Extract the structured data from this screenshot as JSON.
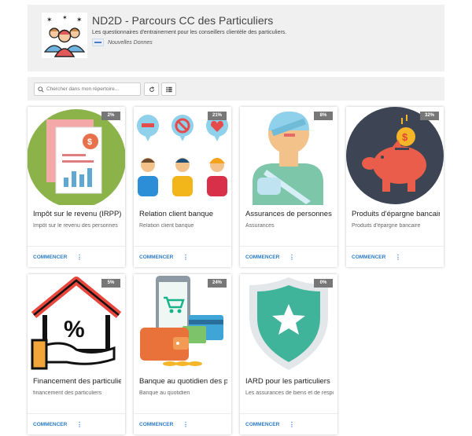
{
  "header": {
    "title": "ND2D - Parcours CC des Particuliers",
    "description": "Les questionnaires d'entrainement pour les conseillers clientèle des particuliers.",
    "publisher": "Nouvelles Donnes"
  },
  "toolbar": {
    "search_placeholder": "Chercher dans mon répertoire..."
  },
  "cards": [
    {
      "title": "Impôt sur le revenu (IRPP)",
      "description": "Impôt sur le revenu des personnes",
      "progress": "2%",
      "action": "COMMENCER",
      "more": "⋮",
      "icon": "tax-document-icon"
    },
    {
      "title": "Relation client banque",
      "description": "Relation client banque",
      "progress": "21%",
      "action": "COMMENCER",
      "more": "⋮",
      "icon": "customer-relation-icon"
    },
    {
      "title": "Assurances de personnes",
      "description": "Assurances",
      "progress": "8%",
      "action": "COMMENCER",
      "more": "⋮",
      "icon": "injured-person-icon"
    },
    {
      "title": "Produits d'épargne bancaire",
      "description": "Produits d'épargne bancaire",
      "progress": "32%",
      "action": "COMMENCER",
      "more": "⋮",
      "icon": "piggy-bank-icon"
    },
    {
      "title": "Financement des particuliers",
      "description": "financement des particuliers",
      "progress": "5%",
      "action": "COMMENCER",
      "more": "⋮",
      "icon": "house-loan-icon"
    },
    {
      "title": "Banque au quotidien des particuliers",
      "description": "Banque au quotidien",
      "progress": "24%",
      "action": "COMMENCER",
      "more": "⋮",
      "icon": "wallet-phone-icon"
    },
    {
      "title": "IARD pour les particuliers",
      "description": "Les assurances de biens et de responsabilité",
      "progress": "0%",
      "action": "COMMENCER",
      "more": "⋮",
      "icon": "shield-star-icon"
    }
  ]
}
